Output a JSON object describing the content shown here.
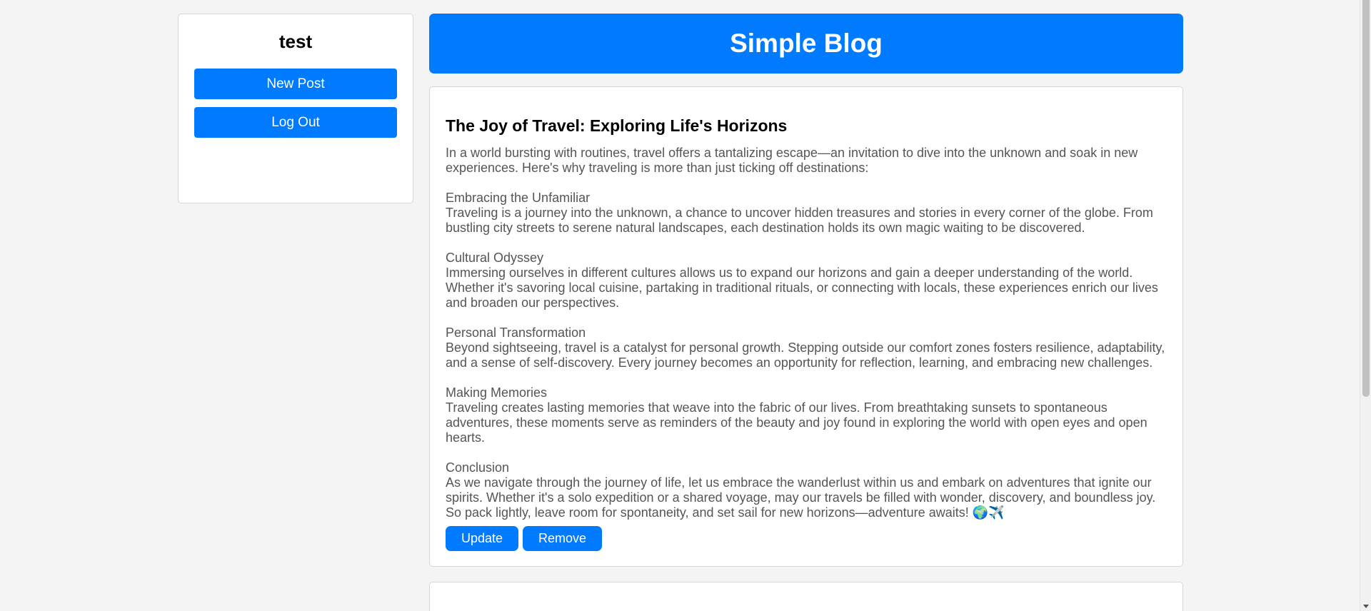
{
  "sidebar": {
    "username": "test",
    "new_post_label": "New Post",
    "logout_label": "Log Out"
  },
  "header": {
    "title": "Simple Blog"
  },
  "post": {
    "title": "The Joy of Travel: Exploring Life's Horizons",
    "intro": "In a world bursting with routines, travel offers a tantalizing escape—an invitation to dive into the unknown and soak in new experiences. Here's why traveling is more than just ticking off destinations:",
    "sections": [
      {
        "heading": "Embracing the Unfamiliar",
        "text": "Traveling is a journey into the unknown, a chance to uncover hidden treasures and stories in every corner of the globe. From bustling city streets to serene natural landscapes, each destination holds its own magic waiting to be discovered."
      },
      {
        "heading": "Cultural Odyssey",
        "text": "Immersing ourselves in different cultures allows us to expand our horizons and gain a deeper understanding of the world. Whether it's savoring local cuisine, partaking in traditional rituals, or connecting with locals, these experiences enrich our lives and broaden our perspectives."
      },
      {
        "heading": "Personal Transformation",
        "text": "Beyond sightseeing, travel is a catalyst for personal growth. Stepping outside our comfort zones fosters resilience, adaptability, and a sense of self-discovery. Every journey becomes an opportunity for reflection, learning, and embracing new challenges."
      },
      {
        "heading": "Making Memories",
        "text": "Traveling creates lasting memories that weave into the fabric of our lives. From breathtaking sunsets to spontaneous adventures, these moments serve as reminders of the beauty and joy found in exploring the world with open eyes and open hearts."
      },
      {
        "heading": "Conclusion",
        "text": "As we navigate through the journey of life, let us embrace the wanderlust within us and embark on adventures that ignite our spirits. Whether it's a solo expedition or a shared voyage, may our travels be filled with wonder, discovery, and boundless joy. So pack lightly, leave room for spontaneity, and set sail for new horizons—adventure awaits! 🌍✈️"
      }
    ],
    "update_label": "Update",
    "remove_label": "Remove"
  },
  "colors": {
    "accent": "#007bff",
    "background": "#f4f4f4",
    "body_text": "#555555"
  }
}
